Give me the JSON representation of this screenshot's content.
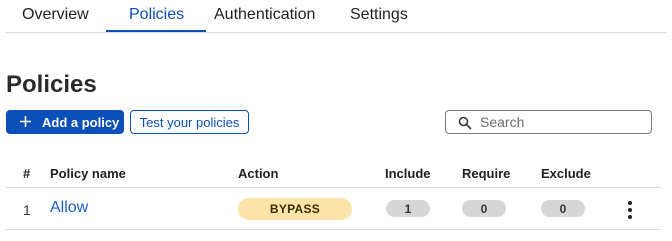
{
  "tabs": [
    {
      "label": "Overview",
      "active": false
    },
    {
      "label": "Policies",
      "active": true
    },
    {
      "label": "Authentication",
      "active": false
    },
    {
      "label": "Settings",
      "active": false
    }
  ],
  "page": {
    "title": "Policies"
  },
  "toolbar": {
    "add_policy_label": "Add a policy",
    "add_icon": "plus-icon",
    "test_policies_label": "Test your policies"
  },
  "search": {
    "placeholder": "Search",
    "value": "",
    "icon": "search-icon"
  },
  "table": {
    "columns": [
      "#",
      "Policy name",
      "Action",
      "Include",
      "Require",
      "Exclude"
    ],
    "rows": [
      {
        "index": "1",
        "name": "Allow",
        "action": "BYPASS",
        "include": "1",
        "require": "0",
        "exclude": "0",
        "menu_icon": "kebab-menu-icon"
      }
    ]
  },
  "colors": {
    "accent": "#0b4fb8",
    "link": "#1a5ed1",
    "bypass_badge": "#fce4a8",
    "count_pill": "#d6d6d6"
  }
}
